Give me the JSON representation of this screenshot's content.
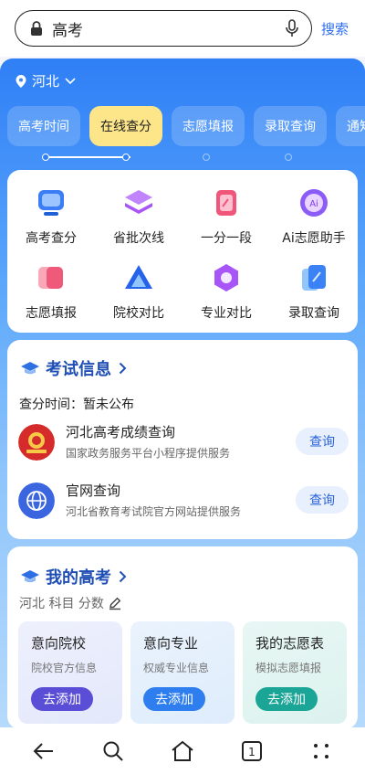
{
  "search": {
    "query": "高考",
    "button": "搜索"
  },
  "region": {
    "name": "河北"
  },
  "tabs": [
    {
      "label": "高考时间"
    },
    {
      "label": "在线查分"
    },
    {
      "label": "志愿填报"
    },
    {
      "label": "录取查询"
    },
    {
      "label": "通知"
    }
  ],
  "tools": [
    {
      "label": "高考查分",
      "icon": "tv-screen-icon",
      "color": "#3b7df5"
    },
    {
      "label": "省批次线",
      "icon": "layers-icon",
      "color": "#a855f7"
    },
    {
      "label": "一分一段",
      "icon": "ticket-icon",
      "color": "#f0557a"
    },
    {
      "label": "Ai志愿助手",
      "icon": "ai-icon",
      "color": "#8b5cf6"
    },
    {
      "label": "志愿填报",
      "icon": "card-stack-icon",
      "color": "#f05a7a"
    },
    {
      "label": "院校对比",
      "icon": "triangle-icon",
      "color": "#2563eb"
    },
    {
      "label": "专业对比",
      "icon": "hexagon-icon",
      "color": "#a855f7"
    },
    {
      "label": "录取查询",
      "icon": "document-icon",
      "color": "#3b82f6"
    }
  ],
  "exam": {
    "title": "考试信息",
    "time_label": "查分时间：暂未公布",
    "items": [
      {
        "name": "河北高考成绩查询",
        "sub": "国家政务服务平台小程序提供服务",
        "button": "查询",
        "icon": "gov-emblem-icon"
      },
      {
        "name": "官网查询",
        "sub": "河北省教育考试院官方网站提供服务",
        "button": "查询",
        "icon": "globe-icon"
      }
    ]
  },
  "mine": {
    "title": "我的高考",
    "meta": "河北 科目 分数",
    "cards": [
      {
        "title": "意向院校",
        "sub": "院校官方信息",
        "button": "去添加",
        "color": "#5b4ed6"
      },
      {
        "title": "意向专业",
        "sub": "权威专业信息",
        "button": "去添加",
        "color": "#2f7ef0"
      },
      {
        "title": "我的志愿表",
        "sub": "模拟志愿填报",
        "button": "去添加",
        "color": "#1aa596"
      }
    ]
  },
  "nav": {
    "tab_count": "1"
  }
}
